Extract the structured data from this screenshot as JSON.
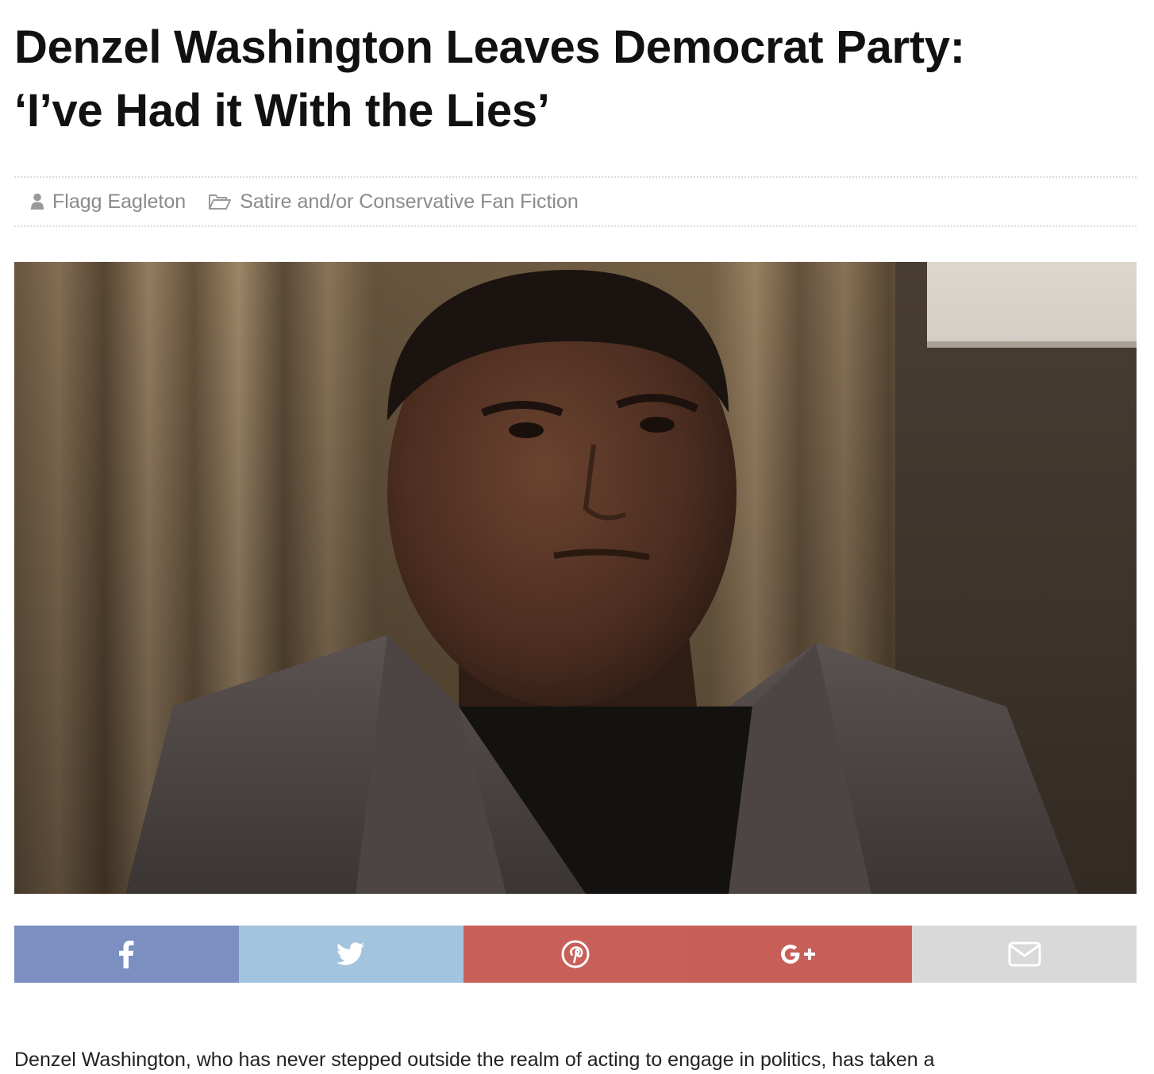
{
  "article": {
    "title_line1": "Denzel Washington Leaves Democrat Party:",
    "title_line2": "‘I’ve Had it With the Lies’",
    "author": "Flagg Eagleton",
    "category": "Satire and/or Conservative Fan Fiction",
    "body_first_line": "Denzel Washington, who has never stepped outside the realm of acting to engage in politics, has taken a"
  },
  "share": {
    "buttons": [
      {
        "name": "facebook",
        "icon": "facebook-icon",
        "color": "#7b8fc1"
      },
      {
        "name": "twitter",
        "icon": "twitter-icon",
        "color": "#a3c4de"
      },
      {
        "name": "pinterest",
        "icon": "pinterest-icon",
        "color": "#c8605a"
      },
      {
        "name": "google-plus",
        "icon": "google-plus-icon",
        "color": "#c65f58"
      },
      {
        "name": "email",
        "icon": "envelope-icon",
        "color": "#d9d9d9"
      }
    ]
  },
  "image": {
    "alt": "photo of man in grey blazer"
  },
  "colors": {
    "meta_text": "#8a8a8a",
    "divider": "#dcdcdc"
  }
}
